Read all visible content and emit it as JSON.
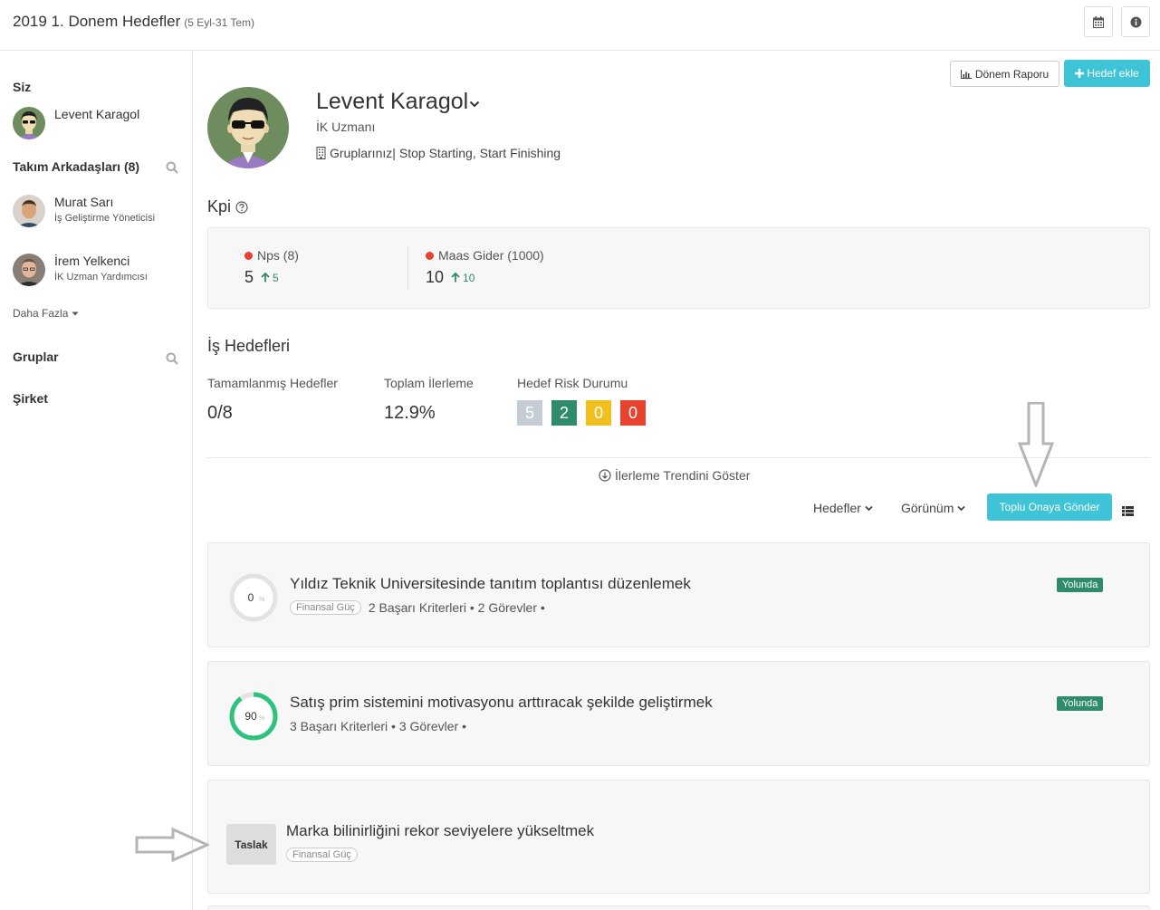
{
  "header": {
    "title": "2019 1. Donem Hedefler",
    "subtitle": "(5 Eyl-31 Tem)",
    "calendar_icon": "calendar-icon",
    "info_icon": "info-icon"
  },
  "sidebar": {
    "me_heading": "Siz",
    "me_name": "Levent Karagol",
    "team_heading": "Takım Arkadaşları (8)",
    "teammates": [
      {
        "name": "Murat Sarı",
        "role": "İş Geliştirme Yöneticisi"
      },
      {
        "name": "İrem Yelkenci",
        "role": "İK Uzman Yardımcısı"
      }
    ],
    "more_label": "Daha Fazla",
    "groups_heading": "Gruplar",
    "company_heading": "Şirket"
  },
  "actions": {
    "report_label": "Dönem Raporu",
    "add_goal_label": "Hedef ekle"
  },
  "profile": {
    "name": "Levent Karagol",
    "role": "İK Uzmanı",
    "groups_label": "Gruplarınız|",
    "groups_value": "Stop Starting, Start Finishing"
  },
  "kpi": {
    "heading": "Kpi",
    "items": [
      {
        "label": "Nps (8)",
        "value": "5",
        "delta": "5",
        "dot_color": "#e8412e"
      },
      {
        "label": "Maas Gider (1000)",
        "value": "10",
        "delta": "10",
        "dot_color": "#e8412e"
      }
    ]
  },
  "goals_section": {
    "heading": "İş Hedefleri",
    "completed_label": "Tamamlanmış Hedefler",
    "completed_value": "0/8",
    "progress_label": "Toplam İlerleme",
    "progress_value": "12.9%",
    "risk_label": "Hedef Risk Durumu",
    "risk_counts": [
      {
        "value": "5",
        "color": "#c5ccd6"
      },
      {
        "value": "2",
        "color": "#2e8b6b"
      },
      {
        "value": "0",
        "color": "#f2c01e"
      },
      {
        "value": "0",
        "color": "#e8412e"
      }
    ],
    "trend_label": "İlerleme Trendini Göster",
    "filter_goals": "Hedefler",
    "filter_view": "Görünüm",
    "bulk_approve": "Toplu Onaya Gönder"
  },
  "goals": [
    {
      "title": "Yıldız Teknik Universitesinde tanıtım toplantısı düzenlemek",
      "progress": 0,
      "progress_label": "0",
      "tag": "Finansal Güç",
      "meta": "2 Başarı Kriterleri • 2 Görevler •",
      "status": "Yolunda"
    },
    {
      "title": "Satış prim sistemini motivasyonu arttıracak şekilde geliştirmek",
      "progress": 90,
      "progress_label": "90",
      "tag": "",
      "meta": "3 Başarı Kriterleri • 3 Görevler •",
      "status": "Yolunda"
    },
    {
      "title": "Marka bilinirliğini rekor seviyelere yükseltmek",
      "draft_label": "Taslak",
      "tag": "Finansal Güç"
    }
  ],
  "colors": {
    "accent": "#3ec4d6",
    "on_track": "#2e8b6b",
    "progress_ring": "#2ec27e"
  }
}
